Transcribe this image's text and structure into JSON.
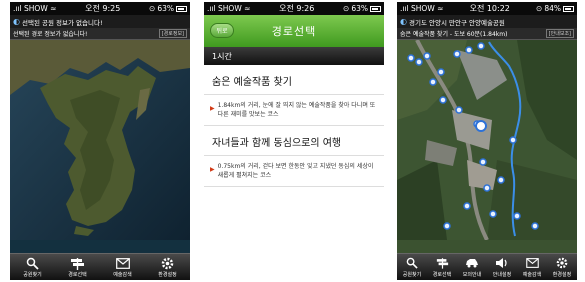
{
  "screens": [
    {
      "status": {
        "carrier": "SHOW",
        "time": "오전 9:25",
        "battery": "63%"
      },
      "notice": "선택된 공원 정보가 없습니다!",
      "route_bar": {
        "text": "선택된 경로 정보가 없습니다!",
        "button": "[경로정보]"
      },
      "tabs": [
        "공원찾기",
        "경로선택",
        "예술감색",
        "환경설정"
      ]
    },
    {
      "status": {
        "carrier": "SHOW",
        "time": "오전 9:26",
        "battery": "63%"
      },
      "header": {
        "back": "뒤로",
        "title": "경로선택"
      },
      "section": "1시간",
      "routes": [
        {
          "title": "숨은 예술작품 찾기",
          "desc": "1.84km의 거리, 눈에 잘 띄지 않는 예술작품을 찾아 다니며 또 다른 재미를 맛보는 코스"
        },
        {
          "title": "자녀들과 함께 동심으로의 여행",
          "desc": "0.75km의 거리, 걷다 보면 한동안 잊고 지냈던 동심의 세상이 새롭게 펼쳐지는 코스"
        }
      ]
    },
    {
      "status": {
        "carrier": "SHOW",
        "time": "오전 10:22",
        "battery": "84%"
      },
      "notice": "경기도 안양시 만안구 안양예술공원",
      "route_bar": {
        "text": "숨은 예술작품 찾기 - 도보 60분(1.84km)",
        "button": "[안내보조]"
      },
      "tabs": [
        "공원찾기",
        "경로선택",
        "모의안내",
        "안내설정",
        "예술감색",
        "환경설정"
      ]
    }
  ]
}
